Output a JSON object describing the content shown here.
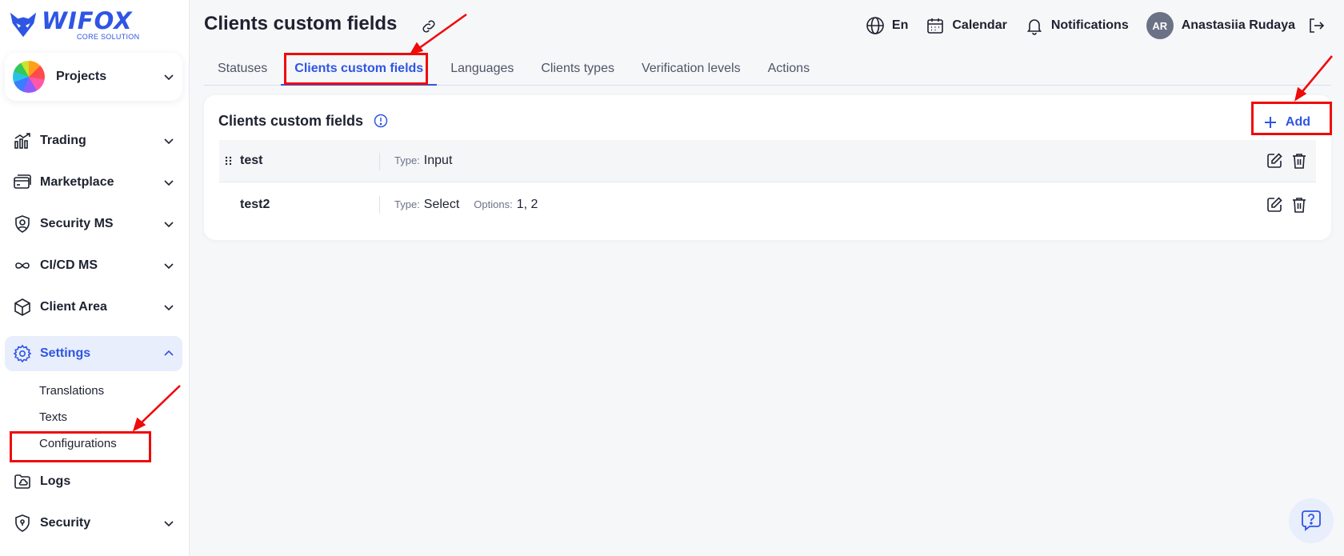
{
  "app": {
    "logo_text": "WIFOX",
    "logo_subtitle": "CORE SOLUTION"
  },
  "colors": {
    "accent": "#2f55e4",
    "annotation": "#f00a0a",
    "active_nav_bg": "#e8eefc",
    "avatar_bg": "#6b7286"
  },
  "sidebar": {
    "projects_label": "Projects",
    "items": [
      {
        "label": "Trading",
        "icon": "chart-growth-icon",
        "has_chevron": true
      },
      {
        "label": "Marketplace",
        "icon": "card-stack-icon",
        "has_chevron": true
      },
      {
        "label": "Security MS",
        "icon": "user-shield-icon",
        "has_chevron": true
      },
      {
        "label": "CI/CD MS",
        "icon": "infinity-loop-icon",
        "has_chevron": true
      },
      {
        "label": "Client Area",
        "icon": "cube-icon",
        "has_chevron": true
      },
      {
        "label": "Settings",
        "icon": "gear-icon",
        "has_chevron": true,
        "expanded": true
      },
      {
        "label": "Logs",
        "icon": "folder-cloud-icon",
        "has_chevron": false
      },
      {
        "label": "Security",
        "icon": "shield-keyhole-icon",
        "has_chevron": true
      }
    ],
    "settings_sub": [
      "Translations",
      "Texts",
      "Configurations"
    ]
  },
  "header": {
    "title": "Clients custom fields",
    "language": "En",
    "calendar": "Calendar",
    "notifications": "Notifications",
    "user_initials": "AR",
    "user_name": "Anastasiia Rudaya"
  },
  "tabs": [
    {
      "label": "Statuses",
      "active": false
    },
    {
      "label": "Clients custom fields",
      "active": true
    },
    {
      "label": "Languages",
      "active": false
    },
    {
      "label": "Clients types",
      "active": false
    },
    {
      "label": "Verification levels",
      "active": false
    },
    {
      "label": "Actions",
      "active": false
    }
  ],
  "card": {
    "title": "Clients custom fields",
    "add_label": "Add",
    "type_key": "Type:",
    "options_key": "Options:",
    "rows": [
      {
        "name": "test",
        "type": "Input",
        "options": null
      },
      {
        "name": "test2",
        "type": "Select",
        "options": "1, 2"
      }
    ]
  }
}
